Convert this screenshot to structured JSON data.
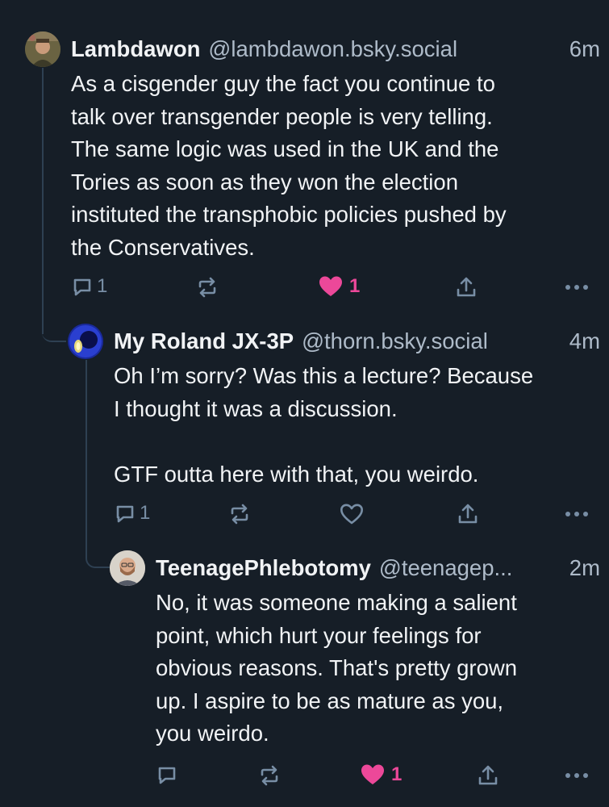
{
  "colors": {
    "background": "#161e27",
    "text": "#f1f3f5",
    "muted": "#aebbc9",
    "icon": "#788ea5",
    "like": "#ec4899",
    "thread_line": "#2e4052"
  },
  "posts": [
    {
      "display_name": "Lambdawon",
      "handle": "@lambdawon.bsky.social",
      "time": "6m",
      "text": "As a cisgender guy the fact you continue to\ntalk over transgender people is very telling.\nThe same logic was used in the UK and the\nTories as soon as they won the election\ninstituted the transphobic policies pushed by\nthe Conservatives.",
      "reply_count": "1",
      "like_count": "1",
      "liked": true
    },
    {
      "display_name": "My Roland JX-3P",
      "handle": "@thorn.bsky.social",
      "time": "4m",
      "text": "Oh I’m sorry? Was this a lecture? Because\nI thought it was a discussion.\n\nGTF outta here with that, you weirdo.",
      "reply_count": "1",
      "like_count": "",
      "liked": false
    },
    {
      "display_name": "TeenagePhlebotomy",
      "handle": "@teenagep...",
      "time": "2m",
      "text": "No, it was someone making a salient\npoint, which hurt your feelings for\nobvious reasons. That's pretty grown\nup. I aspire to be as mature as you,\nyou weirdo.",
      "reply_count": "",
      "like_count": "1",
      "liked": true
    }
  ],
  "icons": {
    "reply": "reply-bubble-icon",
    "repost": "repost-arrows-icon",
    "like": "heart-icon",
    "share": "share-upload-icon",
    "more": "more-dots-icon"
  }
}
